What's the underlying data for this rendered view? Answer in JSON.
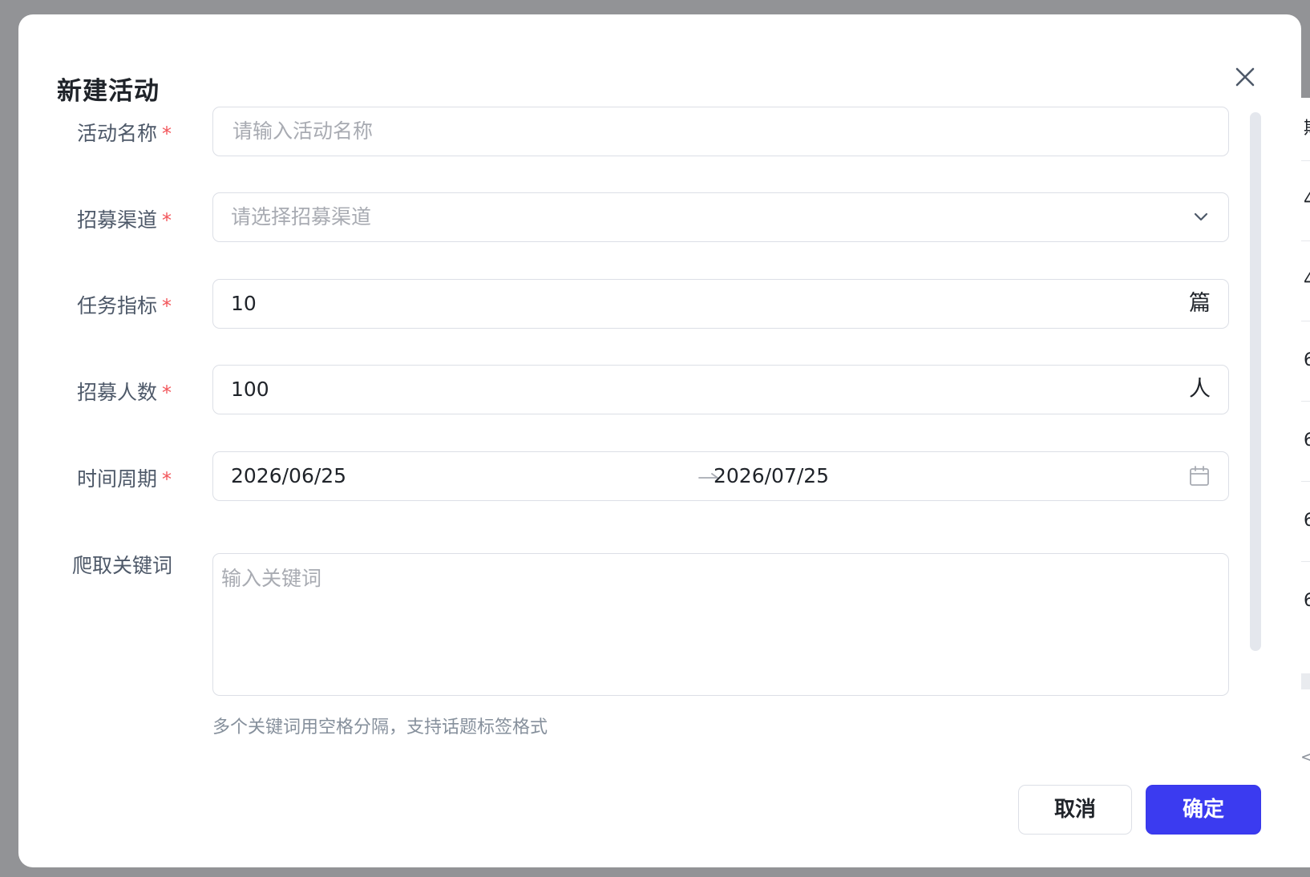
{
  "background": {
    "cells": [
      "期",
      "4",
      "4",
      "6",
      "6",
      "6",
      "6",
      "<"
    ]
  },
  "modal": {
    "title": "新建活动",
    "close_icon": "close-icon"
  },
  "form": {
    "activity_name": {
      "label": "活动名称",
      "required_mark": "*",
      "placeholder": "请输入活动名称",
      "value": ""
    },
    "channel": {
      "label": "招募渠道",
      "required_mark": "*",
      "placeholder": "请选择招募渠道",
      "value": "",
      "icon": "chevron-down-icon"
    },
    "task_target": {
      "label": "任务指标",
      "required_mark": "*",
      "value": "10",
      "suffix": "篇"
    },
    "recruit_count": {
      "label": "招募人数",
      "required_mark": "*",
      "value": "100",
      "suffix": "人"
    },
    "period": {
      "label": "时间周期",
      "required_mark": "*",
      "start": "2026/06/25",
      "end": "2026/07/25",
      "separator_icon": "arrow-right-icon",
      "icon": "calendar-icon"
    },
    "keywords": {
      "label": "爬取关键词",
      "placeholder": "输入关键词",
      "value": "",
      "hint": "多个关键词用空格分隔，支持话题标签格式"
    }
  },
  "footer": {
    "cancel_label": "取消",
    "confirm_label": "确定"
  },
  "colors": {
    "overlay": "#929396",
    "primary": "#3b3bf0",
    "required": "#f2555a",
    "label": "#4e5969",
    "placeholder": "#a8abb2",
    "border": "#dcdfe6"
  }
}
